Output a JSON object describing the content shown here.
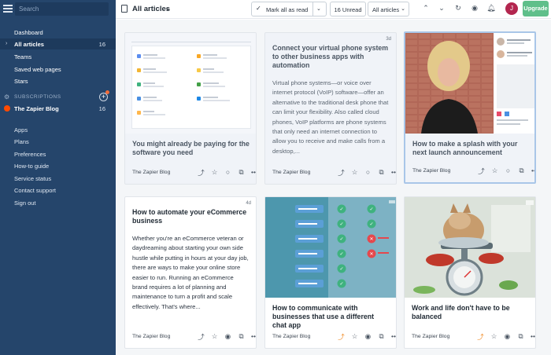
{
  "sidebar": {
    "search_placeholder": "Search",
    "nav": [
      {
        "label": "Dashboard"
      },
      {
        "label": "All articles",
        "count": "16"
      },
      {
        "label": "Teams"
      },
      {
        "label": "Saved web pages"
      },
      {
        "label": "Stars"
      }
    ],
    "subscriptions_label": "SUBSCRIPTIONS",
    "feed": {
      "label": "The Zapier Blog",
      "count": "16"
    },
    "links": [
      "Apps",
      "Plans",
      "Preferences",
      "How-to guide",
      "Service status",
      "Contact support",
      "Sign out"
    ]
  },
  "toolbar": {
    "title": "All articles",
    "mark_all_read": "Mark all as read",
    "unread": "16 Unread",
    "filter": "All articles",
    "avatar_initial": "J",
    "upgrade": "Upgrade"
  },
  "cards": [
    {
      "title": "You might already be paying for the software you need",
      "source": "The Zapier Blog",
      "age": "",
      "image": "app-settings-screenshot",
      "read": true
    },
    {
      "title": "Connect your virtual phone system to other business apps with automation",
      "excerpt": "Virtual phone systems—or voice over internet protocol (VoIP) software—offer an alternative to the traditional desk phone that can limit your flexibility. Also called cloud phones, VoIP platforms are phone systems that only need an internet connection to allow you to receive and make calls from a desktop,...",
      "source": "The Zapier Blog",
      "age": "3d",
      "read": true
    },
    {
      "title": "How to make a splash with your next launch announcement",
      "source": "The Zapier Blog",
      "age": "",
      "image": "woman-portrait-photo",
      "read": true,
      "selected": true
    },
    {
      "title": "How to automate your eCommerce business",
      "excerpt": "Whether you're an eCommerce veteran or daydreaming about starting your own side hustle while putting in hours at your day job, there are ways to make your online store easier to run. Running an eCommerce brand requires a lot of planning and maintenance to turn a profit and scale effectively. That's where...",
      "source": "The Zapier Blog",
      "age": "4d",
      "read": false
    },
    {
      "title": "How to communicate with businesses that use a different chat app",
      "source": "The Zapier Blog",
      "age": "4d",
      "image": "integration-comparison-table",
      "read": false
    },
    {
      "title": "Work and life don't have to be balanced",
      "source": "The Zapier Blog",
      "age": "4d",
      "image": "cat-on-scale-photo",
      "read": false
    }
  ],
  "colors": {
    "sidebar_bg": "#25456b",
    "upgrade_bg": "#5fbf8a",
    "avatar_bg": "#b3264f",
    "trend_hot": "#f08a24"
  },
  "icons": {
    "trend": "trend-icon",
    "star": "star-icon",
    "circle": "mark-read-icon",
    "open": "open-external-icon",
    "more": "more-icon"
  }
}
